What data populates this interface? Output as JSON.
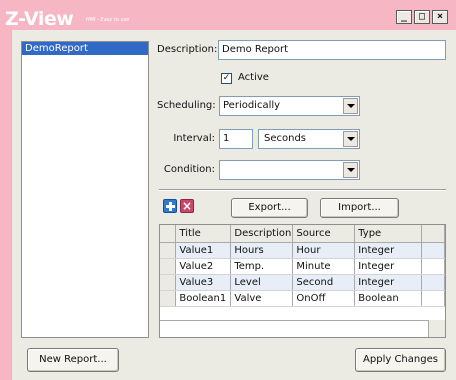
{
  "window": {
    "brand": "Z-View",
    "brand_sub": "HMI - Easy to use",
    "controls": {
      "minimize": "_",
      "maximize": "□",
      "close": "×"
    }
  },
  "reports": {
    "items": [
      "DemoReport"
    ],
    "selected": "DemoReport"
  },
  "form": {
    "description_label": "Description:",
    "description_value": "Demo Report",
    "active_label": "Active",
    "active_checked": true,
    "active_mark": "✓",
    "scheduling_label": "Scheduling:",
    "scheduling_value": "Periodically",
    "interval_label": "Interval:",
    "interval_value": "1",
    "interval_unit": "Seconds",
    "condition_label": "Condition:",
    "condition_value": ""
  },
  "toolbar": {
    "add_icon": "plus-icon",
    "delete_icon": "x-icon",
    "delete_glyph": "×",
    "export_label": "Export...",
    "import_label": "Import..."
  },
  "table": {
    "columns": [
      "Title",
      "Description",
      "Source",
      "Type"
    ],
    "rows": [
      [
        "Value1",
        "Hours",
        "Hour",
        "Integer"
      ],
      [
        "Value2",
        "Temp.",
        "Minute",
        "Integer"
      ],
      [
        "Value3",
        "Level",
        "Second",
        "Integer"
      ],
      [
        "Boolean1",
        "Valve",
        "OnOff",
        "Boolean"
      ]
    ]
  },
  "footer": {
    "new_report_label": "New Report...",
    "apply_label": "Apply Changes"
  },
  "colors": {
    "background": "#f6b6c3",
    "panel": "#ecebe3",
    "selection": "#3169c6",
    "add_icon": "#2f7ad1",
    "delete_icon": "#c7486b"
  }
}
